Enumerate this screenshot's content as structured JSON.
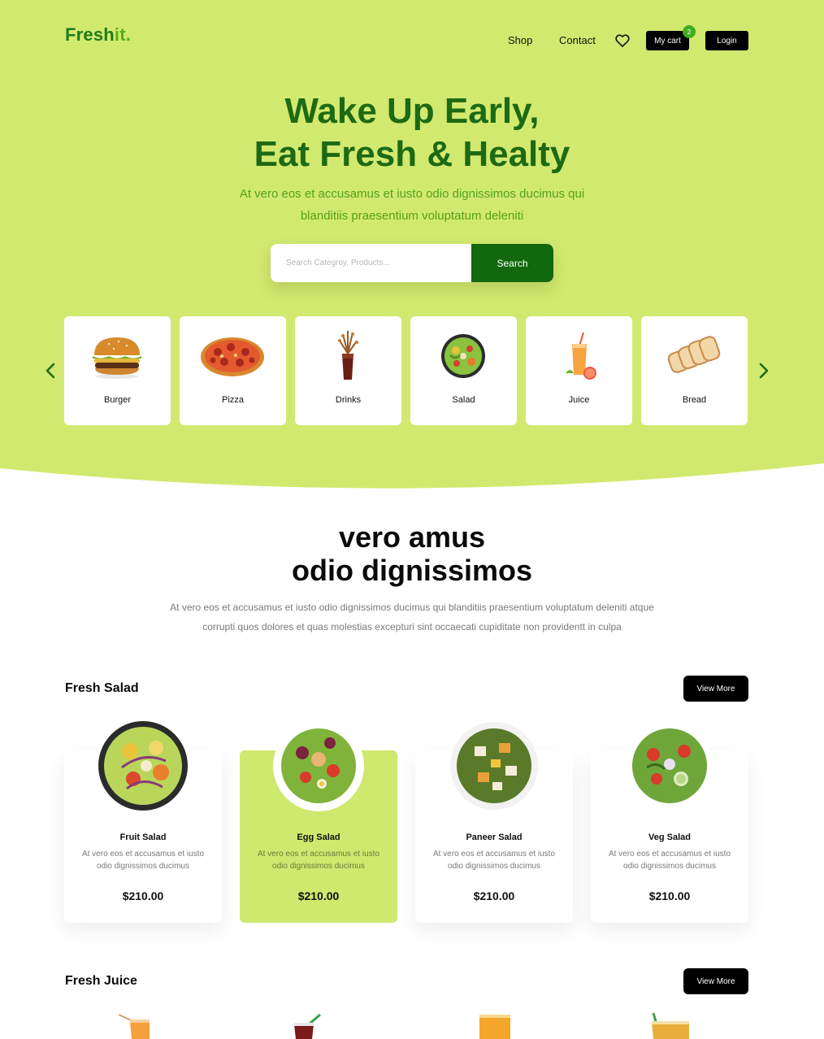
{
  "brand": {
    "name_main": "Fresh",
    "name_accent": "it."
  },
  "nav": {
    "shop": "Shop",
    "contact": "Contact",
    "cart_label": "My cart",
    "cart_count": "2",
    "login": "Login"
  },
  "hero": {
    "title_line1": "Wake Up Early,",
    "title_line2": "Eat Fresh & Healty",
    "subtitle_line1": "At vero eos et accusamus et iusto odio dignissimos ducimus qui",
    "subtitle_line2": "blanditiis praesentium voluptatum deleniti",
    "search_placeholder": "Search Categroy, Products...",
    "search_button": "Search"
  },
  "categories": [
    {
      "label": "Burger",
      "icon": "burger-icon"
    },
    {
      "label": "Pizza",
      "icon": "pizza-icon"
    },
    {
      "label": "Drinks",
      "icon": "drink-icon"
    },
    {
      "label": "Salad",
      "icon": "salad-icon"
    },
    {
      "label": "Juice",
      "icon": "juice-icon"
    },
    {
      "label": "Bread",
      "icon": "bread-icon"
    }
  ],
  "intro": {
    "title_line1": "vero amus",
    "title_line2": "odio dignissimos",
    "text_line1": "At vero eos et accusamus et iusto odio dignissimos ducimus qui blanditiis praesentium voluptatum deleniti atque",
    "text_line2": "corrupti quos dolores et quas molestias excepturi sint occaecati cupiditate non providentt in culpa"
  },
  "salad_section": {
    "title": "Fresh Salad",
    "view_more": "View More",
    "products": [
      {
        "name": "Fruit Salad",
        "desc": "At vero eos et accusamus et iusto odio dignissimos ducimus",
        "price": "$210.00"
      },
      {
        "name": "Egg Salad",
        "desc": "At vero eos et accusamus et iusto odio dignissimos ducimus",
        "price": "$210.00"
      },
      {
        "name": "Paneer Salad",
        "desc": "At vero eos et accusamus et iusto odio dignissimos ducimus",
        "price": "$210.00"
      },
      {
        "name": "Veg Salad",
        "desc": "At vero eos et accusamus et iusto odio dignissimos ducimus",
        "price": "$210.00"
      }
    ]
  },
  "juice_section": {
    "title": "Fresh Juice",
    "view_more": "View More"
  },
  "colors": {
    "hero_bg": "#d2e96f",
    "brand_green": "#1d6a14",
    "accent_green": "#55b11c",
    "button_dark": "#000000",
    "search_button": "#12680d"
  }
}
